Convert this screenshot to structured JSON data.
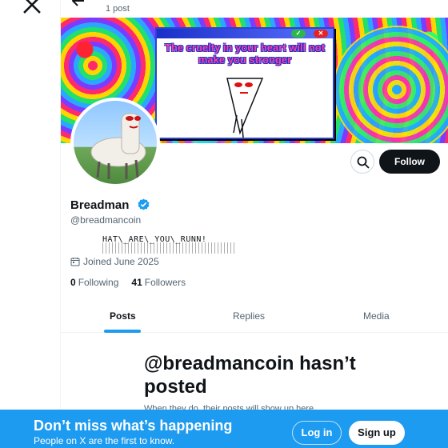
{
  "header": {
    "post_count": "1 post"
  },
  "banner": {
    "popup_text": "The cruelty in your heart will not make you stronger"
  },
  "profile": {
    "display_name": "Breadman",
    "handle": "@breadmancoin",
    "bio": "HAT\\_ARE\\_YOU\\_RUNN!",
    "joined": "Joined June 2025",
    "following_count": "0",
    "following_label": "Following",
    "followers_count": "41",
    "followers_label": "Followers"
  },
  "actions": {
    "follow_label": "Follow"
  },
  "tabs": [
    {
      "label": "Posts"
    },
    {
      "label": "Replies"
    },
    {
      "label": "Media"
    }
  ],
  "empty_state": {
    "title": "@breadmancoin hasn’t posted",
    "subtitle": "When they do, their posts will show up here."
  },
  "signup_bar": {
    "title": "Don’t miss what’s happening",
    "subtitle": "People on X are the first to know.",
    "login_label": "Log in",
    "signup_label": "Sign up"
  },
  "colors": {
    "accent": "#1d9bf0",
    "text": "#0f1419",
    "muted": "#536471",
    "verified": "#1d9bf0"
  },
  "icons": [
    "x-logo-icon",
    "back-arrow-icon",
    "search-icon",
    "verified-badge-icon",
    "calendar-icon"
  ]
}
